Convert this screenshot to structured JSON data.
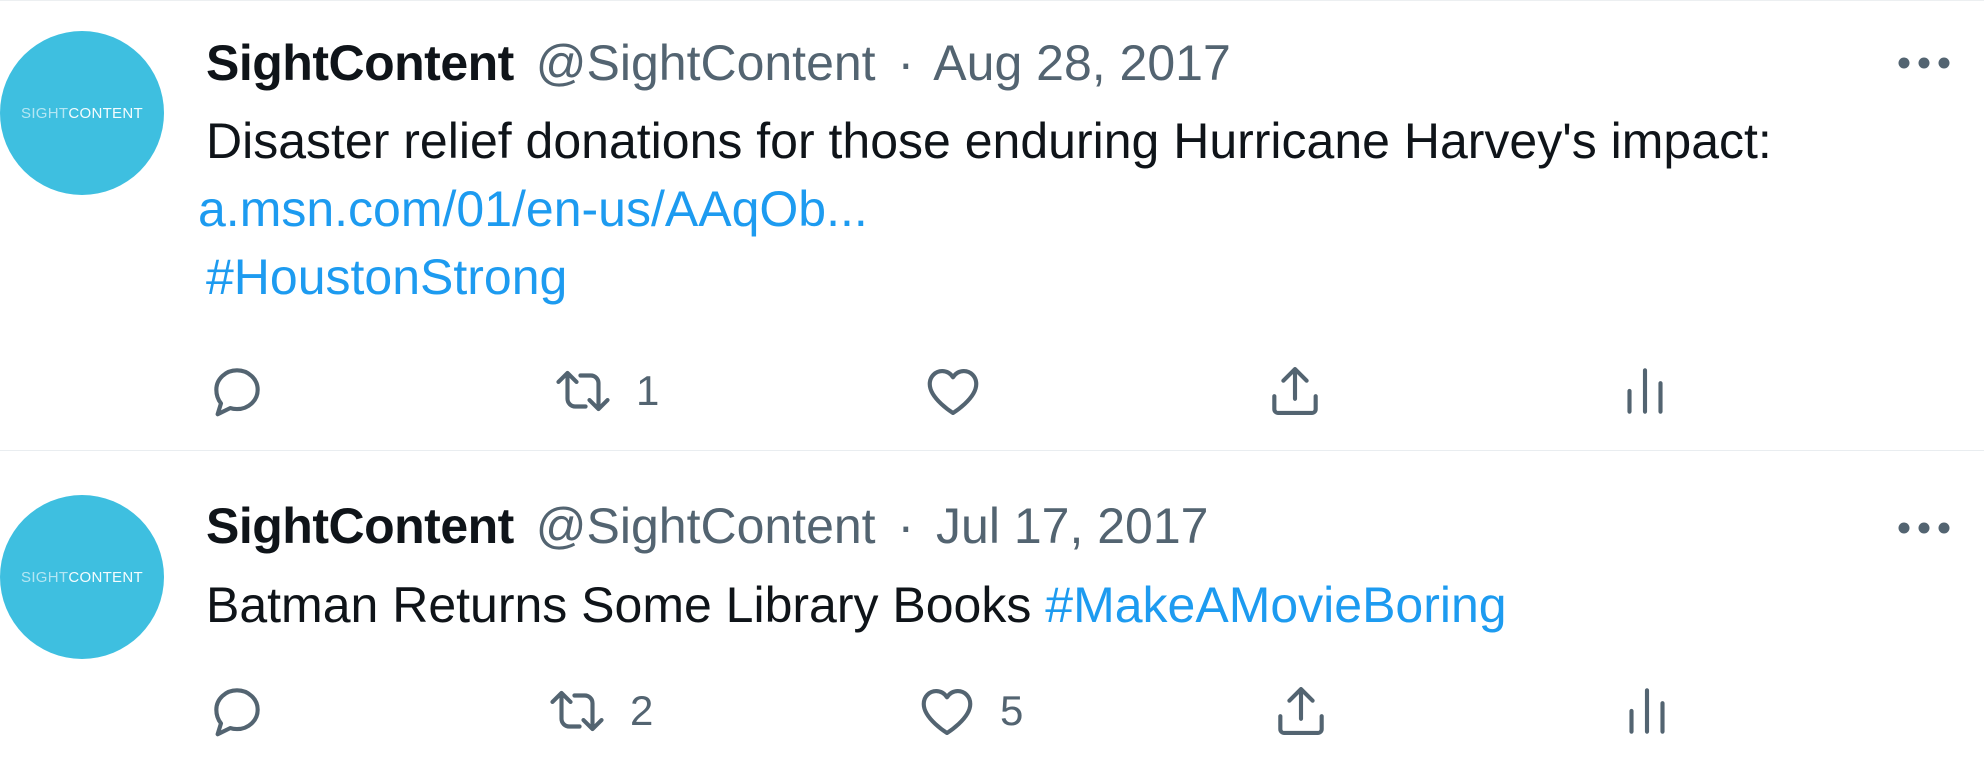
{
  "colors": {
    "avatar_bg": "#3ebfe0",
    "link": "#1d9bf0",
    "secondary": "#536471"
  },
  "tweets": [
    {
      "avatar": {
        "text_light": "SIGHT",
        "text_bold": "CONTENT"
      },
      "name": "SightContent",
      "handle": "@SightContent",
      "separator": "·",
      "date": "Aug 28, 2017",
      "more_icon": "ellipsis-icon",
      "text": "Disaster relief donations for those enduring Hurricane Harvey's impact:",
      "link": "a.msn.com/01/en-us/AAqOb...",
      "hashtag": "#HoustonStrong",
      "actions": {
        "reply_count": "",
        "retweet_count": "1",
        "like_count": ""
      }
    },
    {
      "avatar": {
        "text_light": "SIGHT",
        "text_bold": "CONTENT"
      },
      "name": "SightContent",
      "handle": "@SightContent",
      "separator": "·",
      "date": "Jul 17, 2017",
      "more_icon": "ellipsis-icon",
      "text": "Batman Returns Some Library Books ",
      "hashtag": "#MakeAMovieBoring",
      "actions": {
        "reply_count": "",
        "retweet_count": "2",
        "like_count": "5"
      }
    }
  ]
}
